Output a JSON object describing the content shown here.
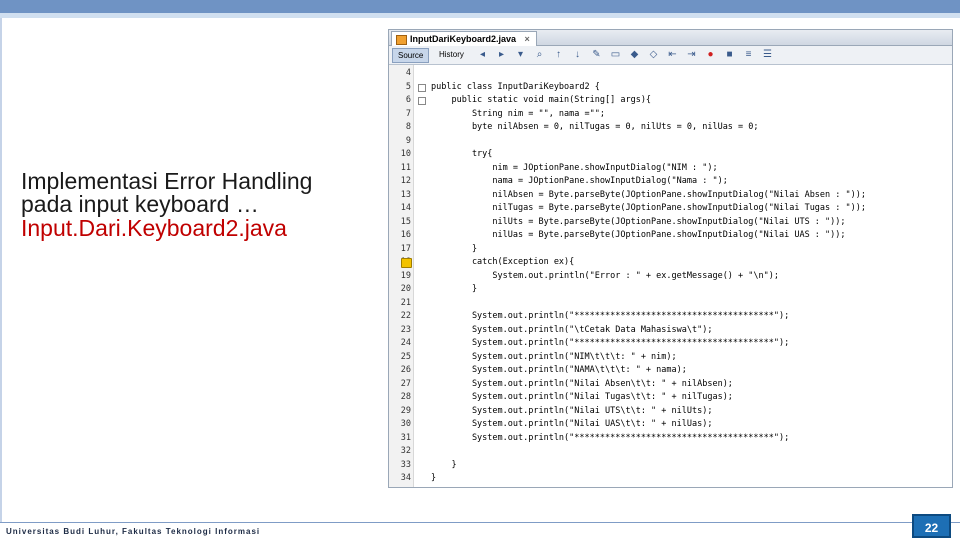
{
  "slide": {
    "title_line1": "Implementasi Error Handling",
    "title_line2": "pada input keyboard …",
    "file_name": "Input.Dari.Keyboard2.java",
    "footer": "Universitas Budi Luhur, Fakultas Teknologi Informasi",
    "page_number": "22"
  },
  "ide": {
    "tab_label": "InputDariKeyboard2.java",
    "tab_close": "×",
    "mode_source": "Source",
    "mode_history": "History",
    "toolbar_icons": [
      "back-icon",
      "forward-icon",
      "dropdown-icon",
      "find-icon",
      "find-prev-icon",
      "find-next-icon",
      "toggle-highlight-icon",
      "select-icon",
      "comment-icon",
      "uncomment-icon",
      "shift-left-icon",
      "shift-right-icon",
      "macro-record-icon",
      "macro-stop-icon",
      "diff-icon",
      "menu-icon"
    ],
    "code_lines": [
      {
        "n": "4",
        "text": ""
      },
      {
        "n": "5",
        "text": "public class InputDariKeyboard2 {"
      },
      {
        "n": "6",
        "text": "    public static void main(String[] args){"
      },
      {
        "n": "7",
        "text": "        String nim = \"\", nama =\"\";"
      },
      {
        "n": "8",
        "text": "        byte nilAbsen = 0, nilTugas = 0, nilUts = 0, nilUas = 0;"
      },
      {
        "n": "9",
        "text": ""
      },
      {
        "n": "10",
        "text": "        try{"
      },
      {
        "n": "11",
        "text": "            nim = JOptionPane.showInputDialog(\"NIM : \");"
      },
      {
        "n": "12",
        "text": "            nama = JOptionPane.showInputDialog(\"Nama : \");"
      },
      {
        "n": "13",
        "text": "            nilAbsen = Byte.parseByte(JOptionPane.showInputDialog(\"Nilai Absen : \"));"
      },
      {
        "n": "14",
        "text": "            nilTugas = Byte.parseByte(JOptionPane.showInputDialog(\"Nilai Tugas : \"));"
      },
      {
        "n": "15",
        "text": "            nilUts = Byte.parseByte(JOptionPane.showInputDialog(\"Nilai UTS : \"));"
      },
      {
        "n": "16",
        "text": "            nilUas = Byte.parseByte(JOptionPane.showInputDialog(\"Nilai UAS : \"));"
      },
      {
        "n": "17",
        "text": "        }"
      },
      {
        "n": "18",
        "text": "        catch(Exception ex){"
      },
      {
        "n": "19",
        "text": "            System.out.println(\"Error : \" + ex.getMessage() + \"\\n\");"
      },
      {
        "n": "20",
        "text": "        }"
      },
      {
        "n": "21",
        "text": ""
      },
      {
        "n": "22",
        "text": "        System.out.println(\"***************************************\");"
      },
      {
        "n": "23",
        "text": "        System.out.println(\"\\tCetak Data Mahasiswa\\t\");"
      },
      {
        "n": "24",
        "text": "        System.out.println(\"***************************************\");"
      },
      {
        "n": "25",
        "text": "        System.out.println(\"NIM\\t\\t\\t: \" + nim);"
      },
      {
        "n": "26",
        "text": "        System.out.println(\"NAMA\\t\\t\\t: \" + nama);"
      },
      {
        "n": "27",
        "text": "        System.out.println(\"Nilai Absen\\t\\t: \" + nilAbsen);"
      },
      {
        "n": "28",
        "text": "        System.out.println(\"Nilai Tugas\\t\\t: \" + nilTugas);"
      },
      {
        "n": "29",
        "text": "        System.out.println(\"Nilai UTS\\t\\t: \" + nilUts);"
      },
      {
        "n": "30",
        "text": "        System.out.println(\"Nilai UAS\\t\\t: \" + nilUas);"
      },
      {
        "n": "31",
        "text": "        System.out.println(\"***************************************\");"
      },
      {
        "n": "32",
        "text": ""
      },
      {
        "n": "33",
        "text": "    }"
      },
      {
        "n": "34",
        "text": "}"
      }
    ]
  }
}
